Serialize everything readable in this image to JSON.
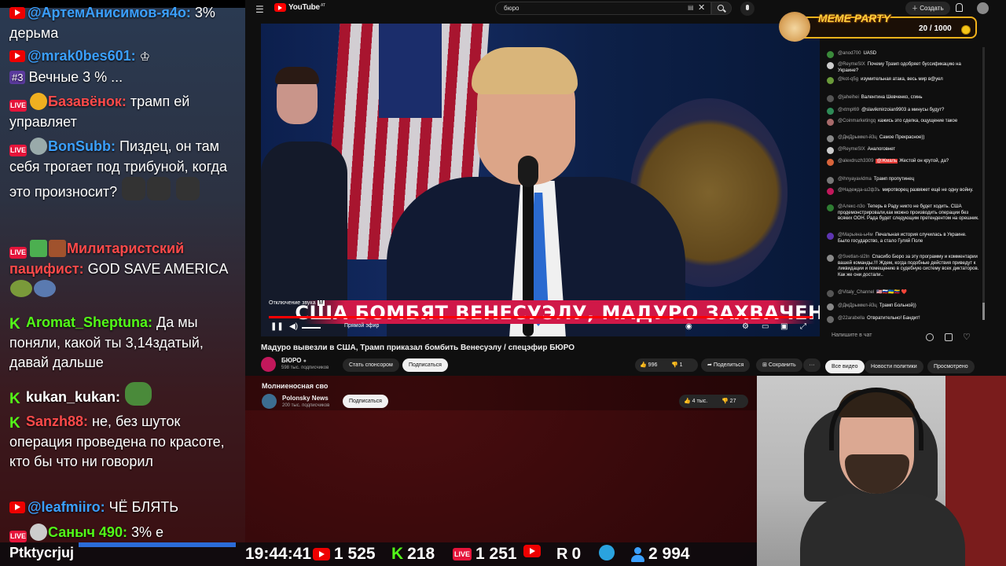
{
  "overlay_chat": {
    "messages": [
      {
        "platform": "yt",
        "user": "@АртемАнисимов-я4о:",
        "user_color": "#3ba0ff",
        "text": "3% дерьма"
      },
      {
        "platform": "yt",
        "user": "@mrak0bes601:",
        "user_color": "#3ba0ff",
        "badge_icon": "crown-icon",
        "text": "Вечные 3 % ...",
        "badge": "#3"
      },
      {
        "platform": "vk",
        "user": "Базавёнок:",
        "user_color": "#ff4a4a",
        "text": "трамп ей управляет"
      },
      {
        "platform": "vk",
        "user": "BonSubb:",
        "user_color": "#3ba0ff",
        "text": "Пиздец, он там себя трогает под трибуной, когда это произносит?"
      },
      {
        "platform": "vk",
        "user": "Милитаристский пацифист:",
        "user_color": "#ff4a4a",
        "text": "GOD SAVE AMERICA"
      },
      {
        "platform": "kick",
        "user": "Aromat_Sheptuna:",
        "user_color": "#53fc18",
        "text": "Да мы поняли, какой ты 3,14здатый, давай дальше"
      },
      {
        "platform": "kick",
        "user": "kukan_kukan:",
        "user_color": "#ffffff",
        "text": ""
      },
      {
        "platform": "kick",
        "user": "Sanzh88:",
        "user_color": "#ff4a4a",
        "text": "не, без шуток операция проведена по красоте, кто бы что ни говорил"
      },
      {
        "platform": "yt",
        "user": "@leafmiiro:",
        "user_color": "#3ba0ff",
        "text": "ЧЁ БЛЯТЬ"
      },
      {
        "platform": "vk",
        "user": "Саныч 490:",
        "user_color": "#53fc18",
        "text": "3% е"
      }
    ]
  },
  "youtube": {
    "logo": "YouTube",
    "logo_sup": "AT",
    "search_value": "бюро",
    "create_label": "Создать",
    "player": {
      "lower_third": "США БОМБЯТ ВЕНЕСУЭЛУ, МАДУРО ЗАХВАЧЕН",
      "mute_hint": "Отключение звука",
      "mute_key": "M",
      "live_label": "Прямой эфир"
    },
    "video_title": "Мадуро вывезли в США, Трамп приказал бомбить Венесуэлу / спецэфир БЮРО",
    "channel": {
      "name": "БЮРО",
      "subs": "598 тыс. подписчиков",
      "sponsor_label": "Стать спонсором",
      "subscribe_label": "Подписаться"
    },
    "actions": {
      "likes": "996",
      "dislikes": "1",
      "share_label": "Поделиться",
      "save_label": "Сохранить",
      "more_label": "···"
    },
    "filters": [
      "Все видео",
      "Новости политики",
      "Просмотрено"
    ],
    "chat": {
      "input_placeholder": "Напишите в чат",
      "messages": [
        {
          "author": "@anod700",
          "text": "UASD",
          "avatar": "#3a8a3a"
        },
        {
          "author": "@ReymeSIX",
          "text": "Почему Трамп одобряет буссификацию на Украине?",
          "avatar": "#cccccc"
        },
        {
          "author": "@kot-q5g",
          "text": "изумительная атака, весь мир в@уел",
          "avatar": "#6a9a3a"
        },
        {
          "author": "@jaheihei",
          "text": "Валентина Шевченко, сгинь",
          "avatar": "#555555"
        },
        {
          "author": "@xtmpl69",
          "text": "@slavikmirzoian9903 а минусы будут?",
          "avatar": "#2e8b57"
        },
        {
          "author": "@Coinmarketingq",
          "text": "кажись это сделка, ощущение такое",
          "avatar": "#a86a6a"
        },
        {
          "author": "@ДмДрыммл-й3ц",
          "text": "Самое Прекрасное))",
          "avatar": "#888888"
        },
        {
          "author": "@ReymeSIX",
          "text": "Аналоговнет",
          "avatar": "#cccccc"
        },
        {
          "author": "@alexdruzh3309",
          "text": "Жестой он крутой, да?",
          "avatar": "#d9643a",
          "mention": "@Жмаль"
        },
        {
          "author": "@ihnyayavidma",
          "text": "Трамп пропутинец",
          "avatar": "#777777"
        },
        {
          "author": "@Надежда-ш2ф3ъ",
          "text": "миротворец развяжет ещё не одну войну.",
          "avatar": "#c2185b"
        },
        {
          "author": "@Алекс-п3о",
          "text": "Теперь в Раду никто не будет ходить. США продемонстрировали,как можно производить операции без всяких ООН. Рада будет следующим претендентом на орешник.",
          "avatar": "#2e7d32"
        },
        {
          "author": "@Марьяна-ы4м",
          "text": "Печальная история случилась в Украине. Было государство, а стало Гуляй Поле",
          "avatar": "#5e35b1"
        },
        {
          "author": "@Svetlan-sl2ln",
          "text": "Спасибо Бюро за эту программу и комментарии вашей команды.!!! Ждем, когда подобные действия приведут к ликвидации и помещению в судебную систему всех диктаторов. Как же они достали..",
          "avatar": "#8a8a8a"
        },
        {
          "author": "@Vitaly_Channel",
          "text": "🇺🇸🇷🇺🇺🇦🇻🇪 ❤️",
          "avatar": "#555555"
        },
        {
          "author": "@ДмДрыммл-й3ц",
          "text": "Трамп Больной))",
          "avatar": "#888888"
        },
        {
          "author": "@22arabella",
          "text": "Отвратительно! Бандит!",
          "avatar": "#6a6a6a"
        }
      ]
    }
  },
  "related": {
    "title": "Молниеносная сво",
    "channel": "Polonsky News",
    "subs": "200 тыс. подписчиков",
    "subscribe_label": "Подписаться",
    "likes": "4 тыс.",
    "dislikes": "27"
  },
  "meme_party": {
    "title": "MEME PARTY",
    "count": "20 / 1000"
  },
  "stats": {
    "username": "Ptktycrjuj",
    "time": "19:44:41",
    "youtube": "1 525",
    "kick": "218",
    "vk": "1 251",
    "rutube_like": "",
    "rutube": "0",
    "telegram": "",
    "viewers": "2 994"
  }
}
